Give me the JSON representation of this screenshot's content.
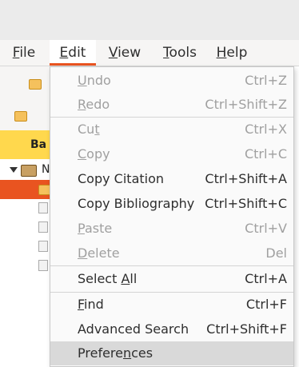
{
  "menubar": {
    "items": [
      {
        "pre": "",
        "ul": "F",
        "post": "ile"
      },
      {
        "pre": "",
        "ul": "E",
        "post": "dit"
      },
      {
        "pre": "",
        "ul": "V",
        "post": "iew"
      },
      {
        "pre": "",
        "ul": "T",
        "post": "ools"
      },
      {
        "pre": "",
        "ul": "H",
        "post": "elp"
      }
    ],
    "active_index": 1,
    "accent_color": "#e95420"
  },
  "background": {
    "header_label": "Ba",
    "tree_letter": "N",
    "highlight_color": "#ffd84d"
  },
  "edit_menu": {
    "items": [
      {
        "pre": "",
        "ul": "U",
        "post": "ndo",
        "shortcut": "Ctrl+Z",
        "enabled": false
      },
      {
        "pre": "",
        "ul": "R",
        "post": "edo",
        "shortcut": "Ctrl+Shift+Z",
        "enabled": false
      },
      {
        "pre": "Cu",
        "ul": "t",
        "post": "",
        "shortcut": "Ctrl+X",
        "enabled": false
      },
      {
        "pre": "",
        "ul": "C",
        "post": "opy",
        "shortcut": "Ctrl+C",
        "enabled": false
      },
      {
        "pre": "Copy Citation",
        "ul": "",
        "post": "",
        "shortcut": "Ctrl+Shift+A",
        "enabled": true
      },
      {
        "pre": "Copy Bibliography",
        "ul": "",
        "post": "",
        "shortcut": "Ctrl+Shift+C",
        "enabled": true
      },
      {
        "pre": "",
        "ul": "P",
        "post": "aste",
        "shortcut": "Ctrl+V",
        "enabled": false
      },
      {
        "pre": "",
        "ul": "D",
        "post": "elete",
        "shortcut": "Del",
        "enabled": false
      },
      {
        "pre": "Select ",
        "ul": "A",
        "post": "ll",
        "shortcut": "Ctrl+A",
        "enabled": true
      },
      {
        "pre": "",
        "ul": "F",
        "post": "ind",
        "shortcut": "Ctrl+F",
        "enabled": true
      },
      {
        "pre": "Advanced Search",
        "ul": "",
        "post": "",
        "shortcut": "Ctrl+Shift+F",
        "enabled": true
      },
      {
        "pre": "Prefere",
        "ul": "n",
        "post": "ces",
        "shortcut": "",
        "enabled": true,
        "highlighted": true
      }
    ]
  }
}
